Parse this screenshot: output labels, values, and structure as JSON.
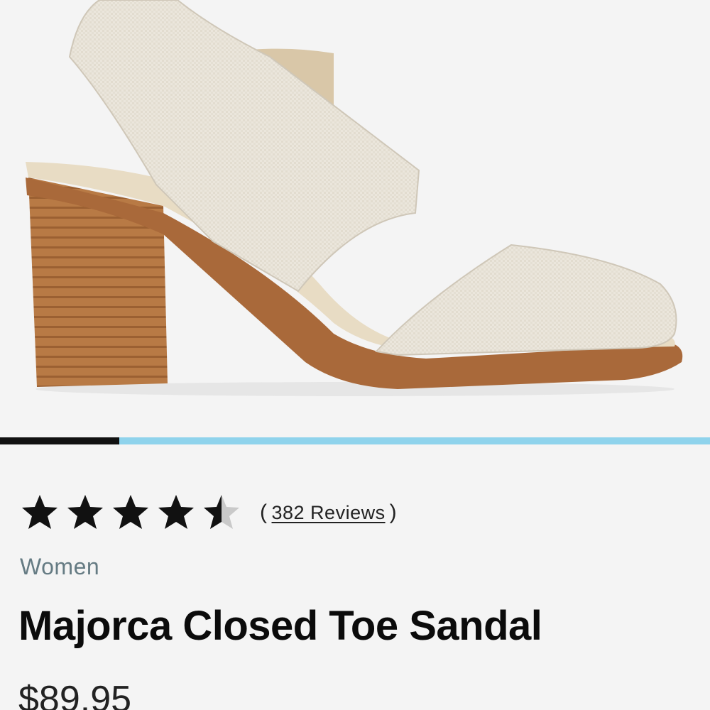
{
  "product": {
    "image_alt": "Majorca Closed Toe Sandal product photo",
    "category": "Women",
    "title": "Majorca Closed Toe Sandal",
    "price": "$89.95"
  },
  "carousel": {
    "progress": 0.168,
    "colors": {
      "active": "#111111",
      "track": "#8fd3ec"
    }
  },
  "rating": {
    "value": 4.5,
    "max": 5,
    "reviews_open": "(",
    "reviews_label": "382 Reviews",
    "reviews_close": ")"
  },
  "colors": {
    "background": "#f4f4f4",
    "star_filled": "#111111",
    "star_empty": "#c9c9c9",
    "category_text": "#657b83"
  }
}
